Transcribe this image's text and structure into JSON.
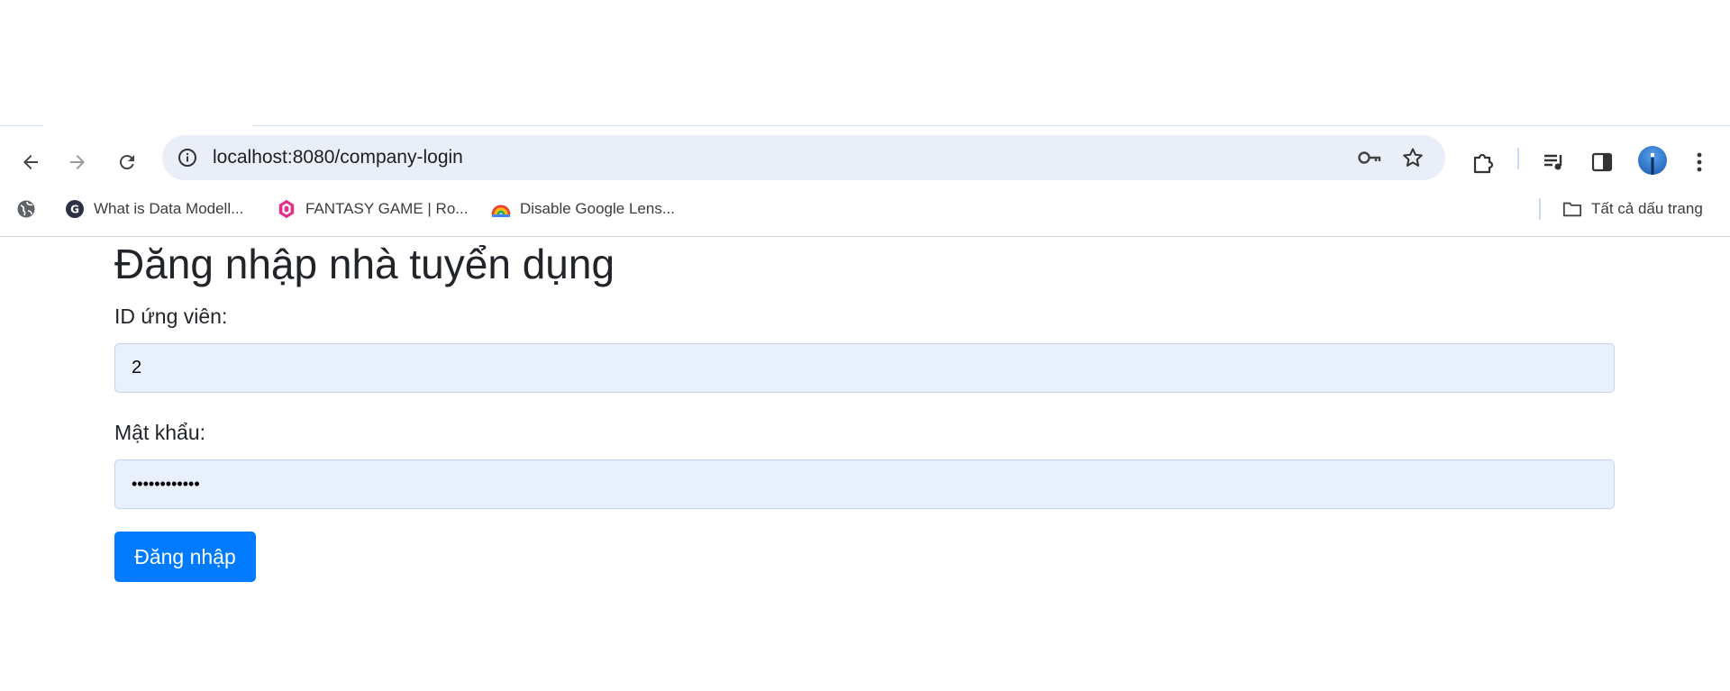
{
  "browser": {
    "url": "localhost:8080/company-login",
    "bookmarks": [
      {
        "label": "What is Data Modell...",
        "icon": "g-favicon-icon"
      },
      {
        "label": "FANTASY GAME | Ro...",
        "icon": "fantasy-game-favicon-icon"
      },
      {
        "label": "Disable Google Lens...",
        "icon": "rainbow-favicon-icon"
      }
    ],
    "all_bookmarks_label": "Tất cả dấu trang"
  },
  "page": {
    "title": "Đăng nhập nhà tuyển dụng",
    "id_label": "ID ứng viên:",
    "id_value": "2",
    "password_label": "Mật khẩu:",
    "password_value": "••••••••••••",
    "login_button": "Đăng nhập"
  },
  "colors": {
    "primary": "#007bff",
    "input_bg": "#e8f0fe",
    "text": "#212529"
  }
}
